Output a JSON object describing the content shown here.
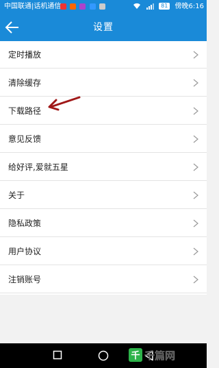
{
  "status_bar": {
    "carrier": "中国联通|话机通信",
    "battery": "81",
    "time_text": "傍晚6:16",
    "app_icons": [
      "red-app-icon",
      "orange-app-icon",
      "purple-app-icon",
      "blue-app-icon",
      "gray-app-icon"
    ]
  },
  "header": {
    "title": "设置",
    "back_icon": "arrow-left-icon"
  },
  "settings": {
    "items": [
      {
        "label": "定时播放"
      },
      {
        "label": "清除缓存"
      },
      {
        "label": "下载路径"
      },
      {
        "label": "意见反馈"
      },
      {
        "label": "给好评,爱就五星"
      },
      {
        "label": "关于"
      },
      {
        "label": "隐私政策"
      },
      {
        "label": "用户协议"
      },
      {
        "label": "注销账号"
      }
    ]
  },
  "nav": {
    "icons": [
      "square-recents-icon",
      "circle-home-icon",
      "triangle-back-icon"
    ]
  },
  "colors": {
    "primary": "#1a8ad8",
    "annotation_arrow": "#a01818"
  }
}
